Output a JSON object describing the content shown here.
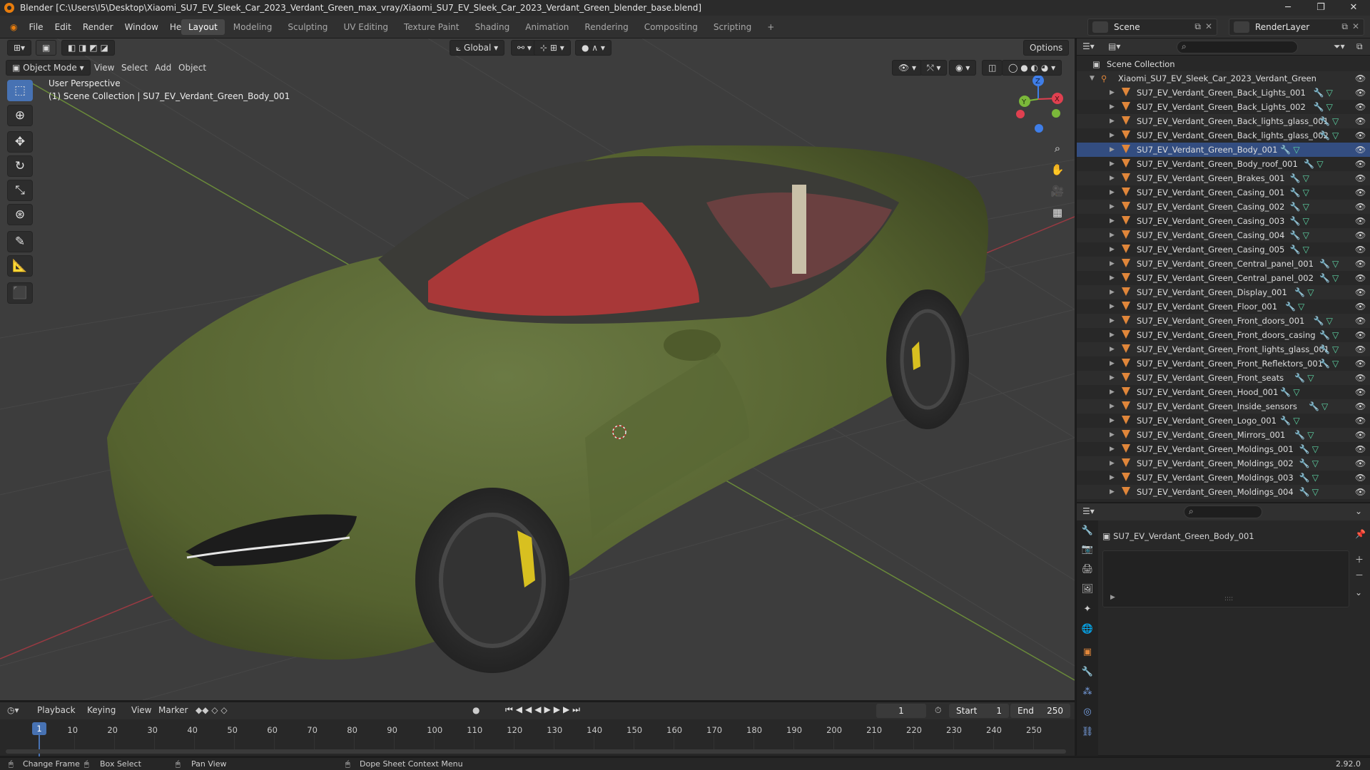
{
  "window": {
    "title": "Blender [C:\\Users\\I5\\Desktop\\Xiaomi_SU7_EV_Sleek_Car_2023_Verdant_Green_max_vray/Xiaomi_SU7_EV_Sleek_Car_2023_Verdant_Green_blender_base.blend]",
    "minimize": "─",
    "maximize": "❐",
    "close": "✕"
  },
  "menu": [
    "File",
    "Edit",
    "Render",
    "Window",
    "Help"
  ],
  "workspaces": [
    {
      "label": "Layout",
      "active": true
    },
    {
      "label": "Modeling"
    },
    {
      "label": "Sculpting"
    },
    {
      "label": "UV Editing"
    },
    {
      "label": "Texture Paint"
    },
    {
      "label": "Shading"
    },
    {
      "label": "Animation"
    },
    {
      "label": "Rendering"
    },
    {
      "label": "Compositing"
    },
    {
      "label": "Scripting"
    },
    {
      "label": "+"
    }
  ],
  "scene": "Scene",
  "render_layer": "RenderLayer",
  "viewport": {
    "mode": "Object Mode",
    "menus": [
      "View",
      "Select",
      "Add",
      "Object"
    ],
    "transform_orientation": "Global",
    "options": "Options",
    "perspective": "User Perspective",
    "collection_info": "(1) Scene Collection | SU7_EV_Verdant_Green_Body_001",
    "gizmo": {
      "x": "X",
      "y": "Y",
      "z": "Z"
    }
  },
  "outliner": {
    "root": "Scene Collection",
    "collection": "Xiaomi_SU7_EV_Sleek_Car_2023_Verdant_Green",
    "items": [
      "SU7_EV_Verdant_Green_Back_Lights_001",
      "SU7_EV_Verdant_Green_Back_Lights_002",
      "SU7_EV_Verdant_Green_Back_lights_glass_001",
      "SU7_EV_Verdant_Green_Back_lights_glass_002",
      "SU7_EV_Verdant_Green_Body_001",
      "SU7_EV_Verdant_Green_Body_roof_001",
      "SU7_EV_Verdant_Green_Brakes_001",
      "SU7_EV_Verdant_Green_Casing_001",
      "SU7_EV_Verdant_Green_Casing_002",
      "SU7_EV_Verdant_Green_Casing_003",
      "SU7_EV_Verdant_Green_Casing_004",
      "SU7_EV_Verdant_Green_Casing_005",
      "SU7_EV_Verdant_Green_Central_panel_001",
      "SU7_EV_Verdant_Green_Central_panel_002",
      "SU7_EV_Verdant_Green_Display_001",
      "SU7_EV_Verdant_Green_Floor_001",
      "SU7_EV_Verdant_Green_Front_doors_001",
      "SU7_EV_Verdant_Green_Front_doors_casing",
      "SU7_EV_Verdant_Green_Front_lights_glass_001",
      "SU7_EV_Verdant_Green_Front_Reflektors_001",
      "SU7_EV_Verdant_Green_Front_seats",
      "SU7_EV_Verdant_Green_Hood_001",
      "SU7_EV_Verdant_Green_Inside_sensors",
      "SU7_EV_Verdant_Green_Logo_001",
      "SU7_EV_Verdant_Green_Mirrors_001",
      "SU7_EV_Verdant_Green_Moldings_001",
      "SU7_EV_Verdant_Green_Moldings_002",
      "SU7_EV_Verdant_Green_Moldings_003",
      "SU7_EV_Verdant_Green_Moldings_004"
    ]
  },
  "properties": {
    "object_name": "SU7_EV_Verdant_Green_Body_001"
  },
  "timeline": {
    "menus": [
      "Playback",
      "Keying",
      "View",
      "Marker"
    ],
    "current_frame": "1",
    "start_label": "Start",
    "start": "1",
    "end_label": "End",
    "end": "250",
    "ticks": [
      "1",
      "10",
      "20",
      "30",
      "40",
      "50",
      "60",
      "70",
      "80",
      "90",
      "100",
      "110",
      "120",
      "130",
      "140",
      "150",
      "160",
      "170",
      "180",
      "190",
      "200",
      "210",
      "220",
      "230",
      "240",
      "250"
    ]
  },
  "status": {
    "change_frame": "Change Frame",
    "box_select": "Box Select",
    "pan_view": "Pan View",
    "context_menu": "Dope Sheet Context Menu",
    "version": "2.92.0"
  }
}
